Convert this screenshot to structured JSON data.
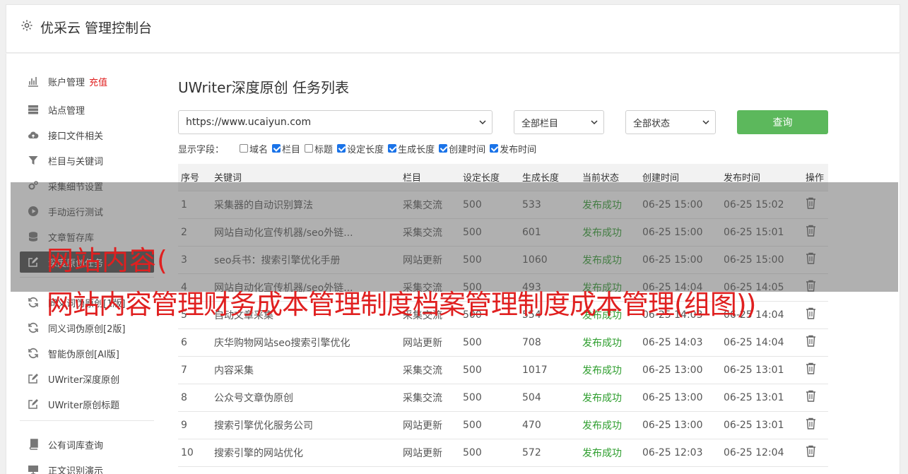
{
  "header": {
    "title": "优采云 管理控制台"
  },
  "sidebar": {
    "items": [
      {
        "label": "账户管理",
        "icon": "bar-chart-icon",
        "badge": "充值"
      },
      {
        "label": "站点管理",
        "icon": "server-icon"
      },
      {
        "label": "接口文件相关",
        "icon": "cloud-upload-icon"
      },
      {
        "label": "栏目与关键词",
        "icon": "filter-icon"
      },
      {
        "label": "采集细节设置",
        "icon": "cogs-icon"
      },
      {
        "label": "手动运行测试",
        "icon": "play-circle-icon"
      },
      {
        "label": "文章暂存库",
        "icon": "database-icon"
      },
      {
        "label": "深度原创任务",
        "icon": "edit-icon",
        "active": true
      },
      {
        "label": "同义词伪原创[1版]",
        "icon": "refresh-icon"
      },
      {
        "label": "同义词伪原创[2版]",
        "icon": "refresh-icon"
      },
      {
        "label": "智能伪原创[AI版]",
        "icon": "refresh-icon"
      },
      {
        "label": "UWriter深度原创",
        "icon": "edit-icon"
      },
      {
        "label": "UWriter原创标题",
        "icon": "edit-icon"
      },
      {
        "label": "公有词库查询",
        "icon": "book-icon"
      },
      {
        "label": "正文识别演示",
        "icon": "monitor-icon"
      }
    ]
  },
  "main": {
    "title": "UWriter深度原创 任务列表",
    "filters": {
      "site": "https://www.ucaiyun.com",
      "column": "全部栏目",
      "status": "全部状态",
      "query_label": "查询"
    },
    "fields_label": "显示字段：",
    "fields": [
      {
        "label": "域名",
        "checked": false
      },
      {
        "label": "栏目",
        "checked": true
      },
      {
        "label": "标题",
        "checked": false
      },
      {
        "label": "设定长度",
        "checked": true
      },
      {
        "label": "生成长度",
        "checked": true
      },
      {
        "label": "创建时间",
        "checked": true
      },
      {
        "label": "发布时间",
        "checked": true
      }
    ],
    "table": {
      "headers": [
        "序号",
        "关键词",
        "栏目",
        "设定长度",
        "生成长度",
        "当前状态",
        "创建时间",
        "发布时间",
        "操作"
      ],
      "rows": [
        [
          "1",
          "采集器的自动识别算法",
          "采集交流",
          "500",
          "533",
          "发布成功",
          "06-25 15:00",
          "06-25 15:02"
        ],
        [
          "2",
          "网站自动化宣传机器/seo外链...",
          "采集交流",
          "500",
          "601",
          "发布成功",
          "06-25 15:00",
          "06-25 15:01"
        ],
        [
          "3",
          "seo兵书：搜索引擎优化手册",
          "网站更新",
          "500",
          "1060",
          "发布成功",
          "06-25 15:00",
          "06-25 15:00"
        ],
        [
          "4",
          "网站自动化宣传机器/seo外链...",
          "采集交流",
          "500",
          "493",
          "发布成功",
          "06-25 14:04",
          "06-25 14:05"
        ],
        [
          "5",
          "自动文章采集",
          "采集交流",
          "500",
          "554",
          "发布成功",
          "06-25 14:03",
          "06-25 14:04"
        ],
        [
          "6",
          "庆华购物网站seo搜索引擎优化",
          "网站更新",
          "500",
          "708",
          "发布成功",
          "06-25 14:03",
          "06-25 14:04"
        ],
        [
          "7",
          "内容采集",
          "采集交流",
          "500",
          "1017",
          "发布成功",
          "06-25 13:00",
          "06-25 13:01"
        ],
        [
          "8",
          "公众号文章伪原创",
          "采集交流",
          "500",
          "504",
          "发布成功",
          "06-25 13:00",
          "06-25 13:01"
        ],
        [
          "9",
          "搜索引擎优化服务公司",
          "网站更新",
          "500",
          "470",
          "发布成功",
          "06-25 13:00",
          "06-25 13:01"
        ],
        [
          "10",
          "搜索引擎的网站优化",
          "网站更新",
          "500",
          "572",
          "发布成功",
          "06-25 12:03",
          "06-25 12:04"
        ]
      ]
    }
  },
  "watermark": {
    "line1": "网站内容(",
    "line2": "网站内容管理财务成本管理制度档案管理制度成本管理(组图))"
  },
  "colors": {
    "accent_green": "#5cb85c",
    "status_green": "#2e9e2e",
    "watermark_red": "#e02020",
    "active_bg": "#4a4a4a"
  }
}
